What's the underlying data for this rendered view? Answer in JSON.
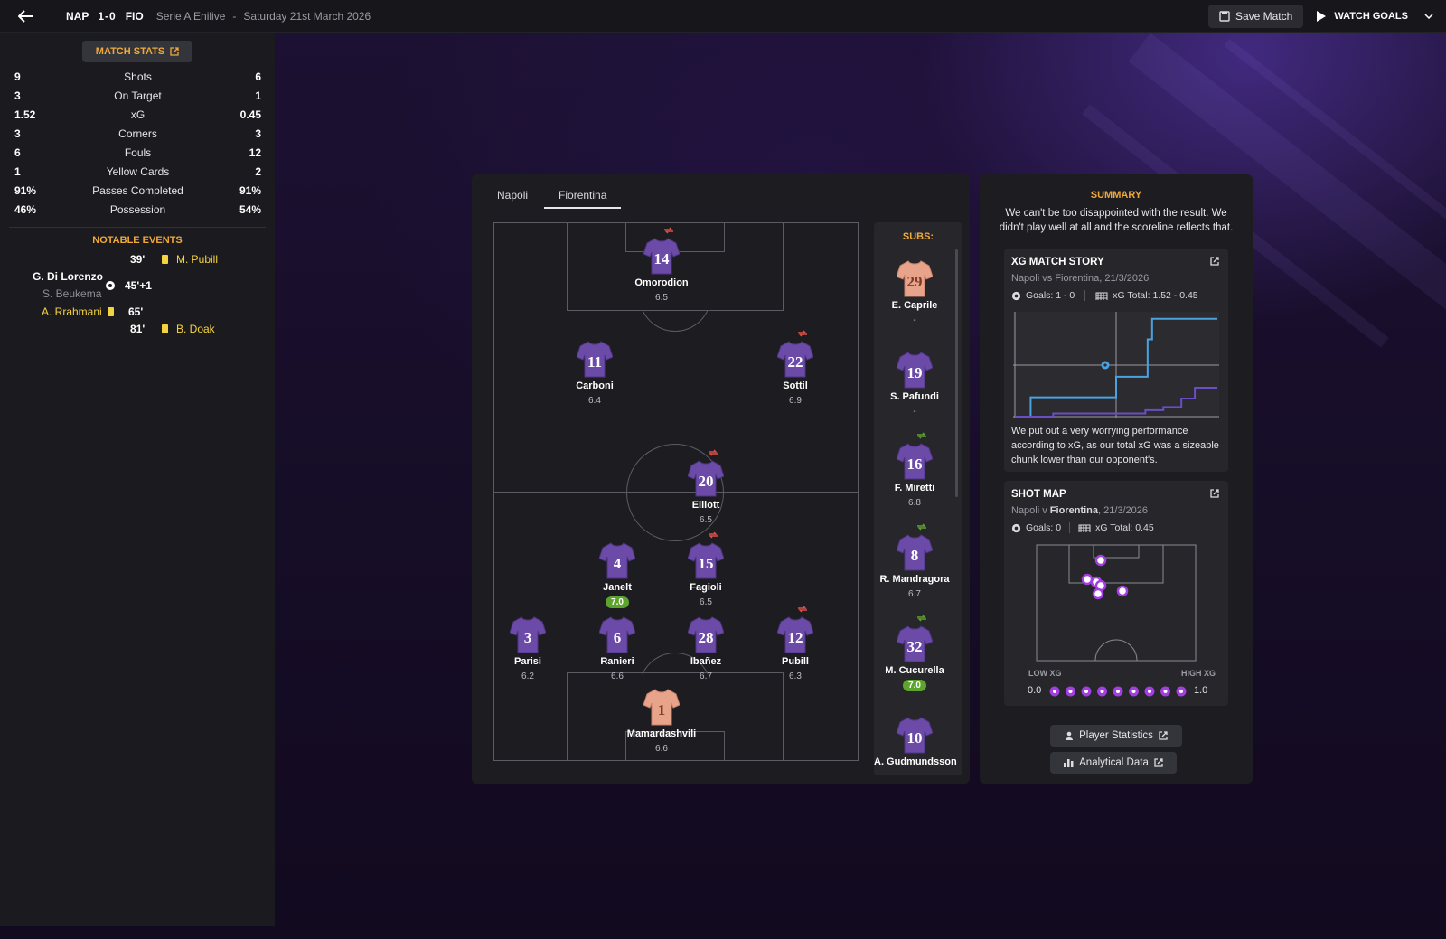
{
  "topbar": {
    "home_abbr": "NAP",
    "score": "1-0",
    "away_abbr": "FIO",
    "competition": "Serie A Enilive",
    "separator": "-",
    "date": "Saturday 21st March 2026",
    "save_label": "Save Match",
    "watch_label": "WATCH GOALS"
  },
  "match_stats": {
    "button_label": "MATCH STATS",
    "rows": [
      {
        "home": "9",
        "label": "Shots",
        "away": "6"
      },
      {
        "home": "3",
        "label": "On Target",
        "away": "1"
      },
      {
        "home": "1.52",
        "label": "xG",
        "away": "0.45"
      },
      {
        "home": "3",
        "label": "Corners",
        "away": "3"
      },
      {
        "home": "6",
        "label": "Fouls",
        "away": "12"
      },
      {
        "home": "1",
        "label": "Yellow Cards",
        "away": "2"
      },
      {
        "home": "91%",
        "label": "Passes Completed",
        "away": "91%"
      },
      {
        "home": "46%",
        "label": "Possession",
        "away": "54%"
      }
    ]
  },
  "notable_events": {
    "title": "NOTABLE EVENTS",
    "events": [
      {
        "minute": "39'",
        "player": "M. Pubill",
        "side": "away",
        "type": "yellow-card"
      },
      {
        "minute": "45'+1",
        "player": "G. Di Lorenzo",
        "assist": "S. Beukema",
        "side": "home",
        "type": "goal"
      },
      {
        "minute": "65'",
        "player": "A. Rrahmani",
        "side": "home",
        "type": "yellow-card"
      },
      {
        "minute": "81'",
        "player": "B. Doak",
        "side": "away",
        "type": "yellow-card"
      }
    ]
  },
  "tabs": [
    "Napoli",
    "Fiorentina"
  ],
  "active_tab": "Fiorentina",
  "lineup": [
    {
      "number": "14",
      "name": "Omorodion",
      "rating": "6.5",
      "sub": "off",
      "kit": "outfield"
    },
    {
      "number": "11",
      "name": "Carboni",
      "rating": "6.4",
      "sub": "",
      "kit": "outfield"
    },
    {
      "number": "22",
      "name": "Sottil",
      "rating": "6.9",
      "sub": "off",
      "kit": "outfield"
    },
    {
      "number": "20",
      "name": "Elliott",
      "rating": "6.5",
      "sub": "off",
      "kit": "outfield"
    },
    {
      "number": "4",
      "name": "Janelt",
      "rating": "7.0",
      "sub": "",
      "kit": "outfield",
      "highlight": true
    },
    {
      "number": "15",
      "name": "Fagioli",
      "rating": "6.5",
      "sub": "off",
      "kit": "outfield"
    },
    {
      "number": "3",
      "name": "Parisi",
      "rating": "6.2",
      "sub": "",
      "kit": "outfield"
    },
    {
      "number": "6",
      "name": "Ranieri",
      "rating": "6.6",
      "sub": "",
      "kit": "outfield"
    },
    {
      "number": "28",
      "name": "Ibañez",
      "rating": "6.7",
      "sub": "",
      "kit": "outfield"
    },
    {
      "number": "12",
      "name": "Pubill",
      "rating": "6.3",
      "sub": "off",
      "kit": "outfield"
    },
    {
      "number": "1",
      "name": "Mamardashvili",
      "rating": "6.6",
      "sub": "",
      "kit": "keeper"
    }
  ],
  "subs": {
    "title": "SUBS:",
    "players": [
      {
        "number": "29",
        "name": "E. Caprile",
        "rating": "-",
        "kit": "keeper",
        "sub": ""
      },
      {
        "number": "19",
        "name": "S. Pafundi",
        "rating": "-",
        "kit": "outfield",
        "sub": ""
      },
      {
        "number": "16",
        "name": "F. Miretti",
        "rating": "6.8",
        "kit": "outfield",
        "sub": "on"
      },
      {
        "number": "8",
        "name": "R. Mandragora",
        "rating": "6.7",
        "kit": "outfield",
        "sub": "on"
      },
      {
        "number": "32",
        "name": "M. Cucurella",
        "rating": "7.0",
        "kit": "outfield",
        "sub": "on",
        "highlight": true
      },
      {
        "number": "10",
        "name": "A. Gudmundsson",
        "rating": "",
        "kit": "outfield",
        "sub": ""
      }
    ]
  },
  "summary": {
    "title": "SUMMARY",
    "text": "We can't be too disappointed with the result. We didn't play well at all and the scoreline reflects that."
  },
  "xg_story": {
    "title": "XG MATCH STORY",
    "subtitle": "Napoli vs Fiorentina, 21/3/2026",
    "goals": "Goals: 1 - 0",
    "xg_total": "xG Total: 1.52 - 0.45",
    "text": "We put out a very worrying performance according to xG, as our total xG was a sizeable chunk lower than our opponent's."
  },
  "chart_data": {
    "type": "line",
    "title": "XG MATCH STORY",
    "xlabel": "",
    "ylabel": "",
    "x_range_minutes": [
      0,
      90
    ],
    "ylim": [
      0,
      1.6
    ],
    "grid": true,
    "series": [
      {
        "color": "#4aa3df",
        "x": [
          0,
          7,
          7,
          45,
          45,
          59,
          59,
          61,
          61,
          90
        ],
        "y": [
          0,
          0,
          0.3,
          0.3,
          0.62,
          0.62,
          1.2,
          1.2,
          1.52,
          1.52
        ]
      },
      {
        "color": "#6b4ec4",
        "x": [
          0,
          17,
          17,
          58,
          58,
          66,
          66,
          74,
          74,
          80,
          80,
          90
        ],
        "y": [
          0,
          0,
          0.05,
          0.05,
          0.1,
          0.1,
          0.15,
          0.15,
          0.28,
          0.28,
          0.45,
          0.45
        ]
      }
    ],
    "goal_marker": {
      "x": 45,
      "y": 0.8,
      "color": "#4aa3df"
    }
  },
  "shot_map": {
    "title": "SHOT MAP",
    "subtitle_home": "Napoli v ",
    "subtitle_away": "Fiorentina",
    "subtitle_date": ", 21/3/2026",
    "goals": "Goals: 0",
    "xg_total": "xG Total: 0.45",
    "low_label": "LOW XG",
    "high_label": "HIGH XG",
    "scale_min": "0.0",
    "scale_max": "1.0",
    "shot_color": "#a33ee0"
  },
  "buttons": {
    "player_stats": "Player Statistics",
    "analytical": "Analytical Data"
  },
  "colors": {
    "accent": "#f0a93a",
    "kit_outfield": "#6b4aa8",
    "kit_keeper": "#e8a48a",
    "good_rating": "#5da42e"
  }
}
